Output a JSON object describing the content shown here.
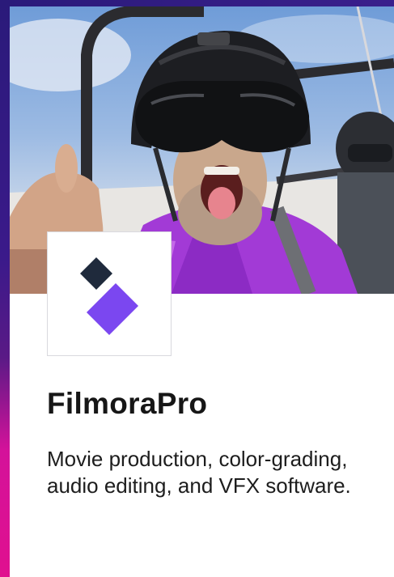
{
  "product": {
    "name": "FilmoraPro",
    "description": "Movie production, color-grading, audio editing, and VFX software."
  },
  "hero": {
    "photo": "off-road-buggy-rider-photo"
  },
  "logo": {
    "icon": "filmora-logo-icon",
    "colors": {
      "dark": "#1f2a3c",
      "accent": "#7b47f0"
    }
  },
  "theme": {
    "strip_top": "#2a1a7a",
    "strip_bottom": "#e0108f"
  }
}
